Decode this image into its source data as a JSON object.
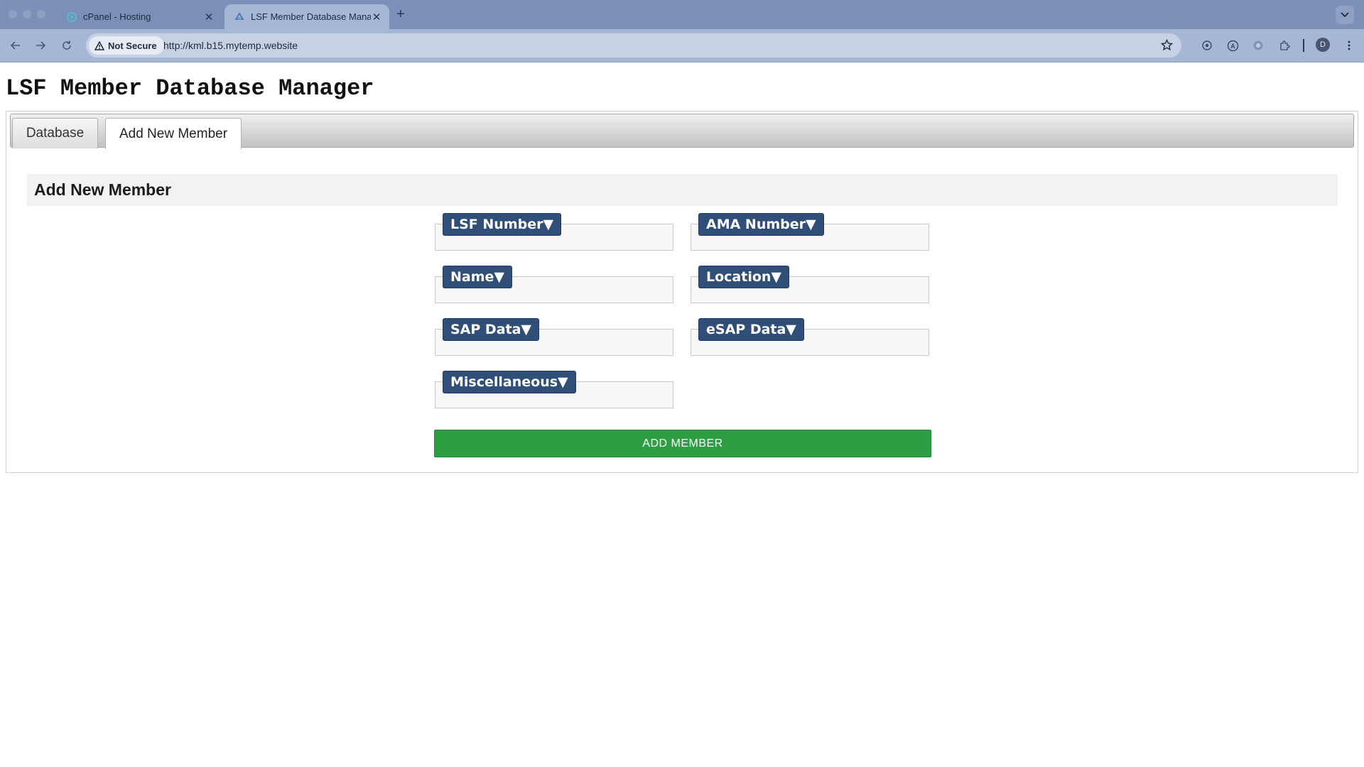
{
  "browser": {
    "tabs": [
      {
        "title": "cPanel - Hosting",
        "icon": "cpanel-icon"
      },
      {
        "title": "LSF Member Database Manag",
        "icon": "site-icon"
      }
    ],
    "security_label": "Not Secure",
    "url": "http://kml.b15.mytemp.website",
    "profile_initial": "D"
  },
  "page": {
    "title": "LSF Member Database Manager",
    "tabs": [
      "Database",
      "Add New Member"
    ],
    "active_tab": "Add New Member",
    "section_title": "Add New Member",
    "fields": {
      "lsf_number": {
        "label": "LSF Number▼",
        "value": ""
      },
      "ama_number": {
        "label": "AMA Number▼",
        "value": ""
      },
      "name": {
        "label": "Name▼",
        "value": ""
      },
      "location": {
        "label": "Location▼",
        "value": ""
      },
      "sap_data": {
        "label": "SAP Data▼",
        "value": ""
      },
      "esap_data": {
        "label": "eSAP Data▼",
        "value": ""
      },
      "miscellaneous": {
        "label": "Miscellaneous▼",
        "value": ""
      }
    },
    "submit_label": "ADD MEMBER"
  },
  "colors": {
    "label_bg": "#2f4f78",
    "button_bg": "#2e9e45",
    "chrome_tabstrip": "#7a90b7",
    "chrome_toolbar": "#a6b7d6"
  }
}
